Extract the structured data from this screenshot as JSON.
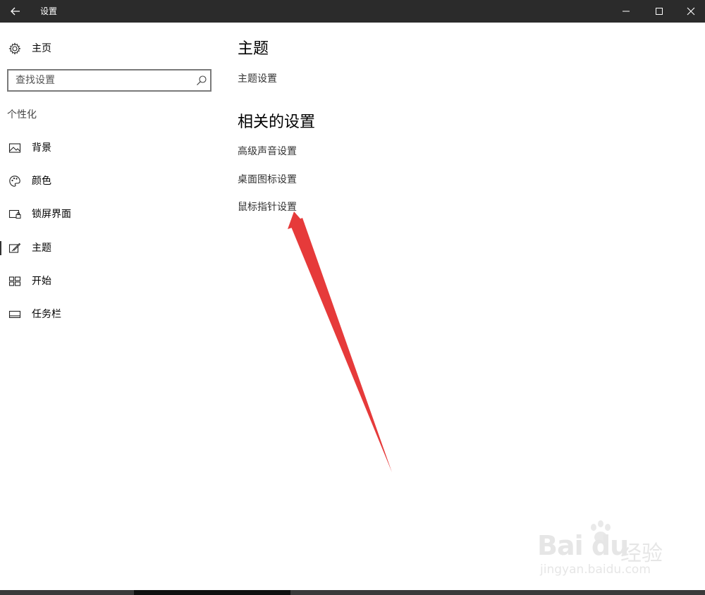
{
  "window": {
    "title": "设置"
  },
  "sidebar": {
    "home_label": "主页",
    "search_placeholder": "查找设置",
    "section_label": "个性化",
    "items": [
      {
        "label": "背景",
        "icon": "picture-icon",
        "selected": false
      },
      {
        "label": "颜色",
        "icon": "palette-icon",
        "selected": false
      },
      {
        "label": "锁屏界面",
        "icon": "lockscreen-icon",
        "selected": false
      },
      {
        "label": "主题",
        "icon": "theme-brush-icon",
        "selected": true
      },
      {
        "label": "开始",
        "icon": "start-tiles-icon",
        "selected": false
      },
      {
        "label": "任务栏",
        "icon": "taskbar-icon",
        "selected": false
      }
    ]
  },
  "main": {
    "heading": "主题",
    "theme_settings_link": "主题设置",
    "related_heading": "相关的设置",
    "related_links": [
      "高级声音设置",
      "桌面图标设置",
      "鼠标指针设置"
    ]
  },
  "annotation": {
    "arrow_color": "#e63a3a",
    "points_to": "鼠标指针设置"
  },
  "watermark": {
    "brand": "Bai du",
    "brand_cn": "经验",
    "url": "jingyan.baidu.com"
  },
  "colors": {
    "titlebar_bg": "#2b2b2b",
    "accent_arrow": "#e63a3a"
  }
}
